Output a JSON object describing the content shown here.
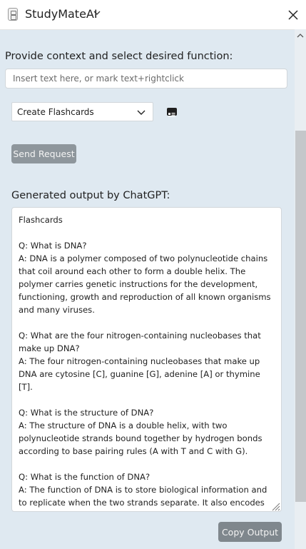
{
  "window": {
    "title": "StudyMateAI"
  },
  "context": {
    "label": "Provide context and select desired function:",
    "placeholder": "Insert text here, or mark text+rightclick",
    "value": ""
  },
  "function_select": {
    "selected": "Create Flashcards"
  },
  "icons": {
    "app": "app-notebook-icon",
    "title_chevron": "chevron-down-icon",
    "close": "close-icon",
    "select_chevron": "chevron-down-icon",
    "card": "id-card-icon",
    "resize": "resize-grip-icon",
    "scroll_up": "scroll-up-arrow-icon"
  },
  "actions": {
    "send_label": "Send Request",
    "copy_label": "Copy Output"
  },
  "output": {
    "label": "Generated output by ChatGPT:",
    "text": "Flashcards\n\nQ: What is DNA?\nA: DNA is a polymer composed of two polynucleotide chains that coil around each other to form a double helix. The polymer carries genetic instructions for the development, functioning, growth and reproduction of all known organisms and many viruses.\n\nQ: What are the four nitrogen-containing nucleobases that make up DNA?\nA: The four nitrogen-containing nucleobases that make up DNA are cytosine [C], guanine [G], adenine [A] or thymine [T].\n\nQ: What is the structure of DNA?\nA: The structure of DNA is a double helix, with two polynucleotide strands bound together by hydrogen bonds according to base pairing rules (A with T and C with G).\n\nQ: What is the function of DNA?\nA: The function of DNA is to store biological information and to replicate when the two strands separate. It also encodes genetic information and is used to produce RNA strands in a process called transcription."
  },
  "colors": {
    "background": "#dfe9f1",
    "button": "#8e969c",
    "titlebar": "#ffffff"
  }
}
